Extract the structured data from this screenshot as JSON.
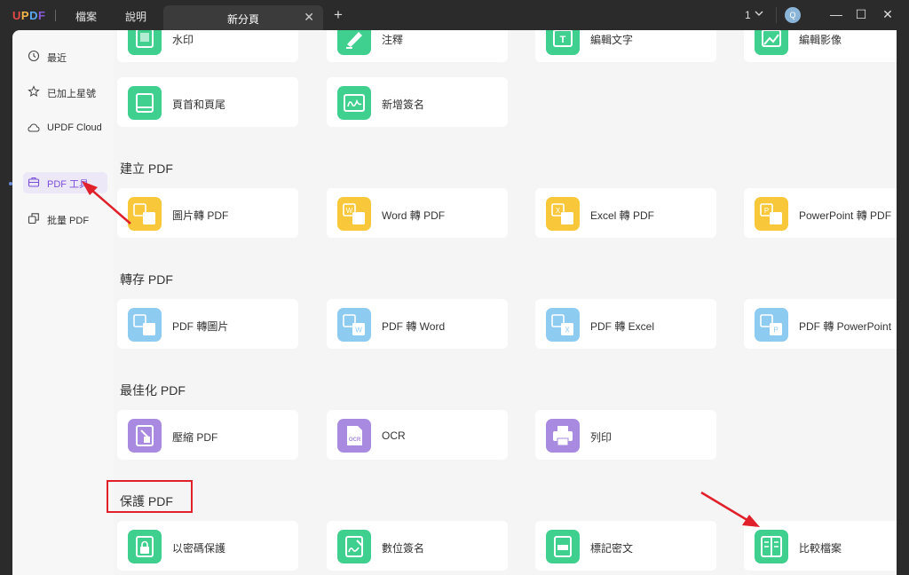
{
  "app": {
    "logo": "UPDF",
    "logo_colors": [
      "#e44a4a",
      "#f5b84a",
      "#5aa8f0",
      "#8a5ad8"
    ],
    "menu": [
      "檔案",
      "說明"
    ],
    "tab_label": "新分頁",
    "page_count": "1",
    "avatar_letter": "Q"
  },
  "sidebar": {
    "items": [
      {
        "label": "最近",
        "icon": "clock-icon"
      },
      {
        "label": "已加上星號",
        "icon": "star-icon"
      },
      {
        "label": "UPDF Cloud",
        "icon": "cloud-icon"
      },
      {
        "label": "PDF 工具",
        "icon": "toolbox-icon"
      },
      {
        "label": "批量 PDF",
        "icon": "batch-icon"
      }
    ]
  },
  "sections": [
    {
      "title": "",
      "cards": [
        {
          "label": "水印",
          "color": "#3fcf8e"
        },
        {
          "label": "注釋",
          "color": "#3fcf8e"
        },
        {
          "label": "編輯文字",
          "color": "#3fcf8e"
        },
        {
          "label": "編輯影像",
          "color": "#3fcf8e"
        }
      ]
    },
    {
      "title": "",
      "cards": [
        {
          "label": "頁首和頁尾",
          "color": "#3fcf8e"
        },
        {
          "label": "新增簽名",
          "color": "#3fcf8e"
        }
      ]
    },
    {
      "title": "建立 PDF",
      "cards": [
        {
          "label": "圖片轉 PDF",
          "color": "#f8c83a"
        },
        {
          "label": "Word 轉 PDF",
          "color": "#f8c83a"
        },
        {
          "label": "Excel 轉 PDF",
          "color": "#f8c83a"
        },
        {
          "label": "PowerPoint 轉 PDF",
          "color": "#f8c83a"
        }
      ]
    },
    {
      "title": "轉存 PDF",
      "cards": [
        {
          "label": "PDF 轉圖片",
          "color": "#8ecbf0"
        },
        {
          "label": "PDF 轉 Word",
          "color": "#8ecbf0"
        },
        {
          "label": "PDF 轉 Excel",
          "color": "#8ecbf0"
        },
        {
          "label": "PDF 轉 PowerPoint",
          "color": "#8ecbf0"
        }
      ]
    },
    {
      "title": "最佳化 PDF",
      "cards": [
        {
          "label": "壓縮 PDF",
          "color": "#a88ae0"
        },
        {
          "label": "OCR",
          "color": "#a88ae0"
        },
        {
          "label": "列印",
          "color": "#a88ae0"
        }
      ]
    },
    {
      "title": "保護 PDF",
      "cards": [
        {
          "label": "以密碼保護",
          "color": "#3fcf8e"
        },
        {
          "label": "數位簽名",
          "color": "#3fcf8e"
        },
        {
          "label": "標記密文",
          "color": "#3fcf8e"
        },
        {
          "label": "比較檔案",
          "color": "#3fcf8e"
        }
      ]
    }
  ],
  "ocr_badge": "OCR",
  "annotation_color": "#e0202a"
}
